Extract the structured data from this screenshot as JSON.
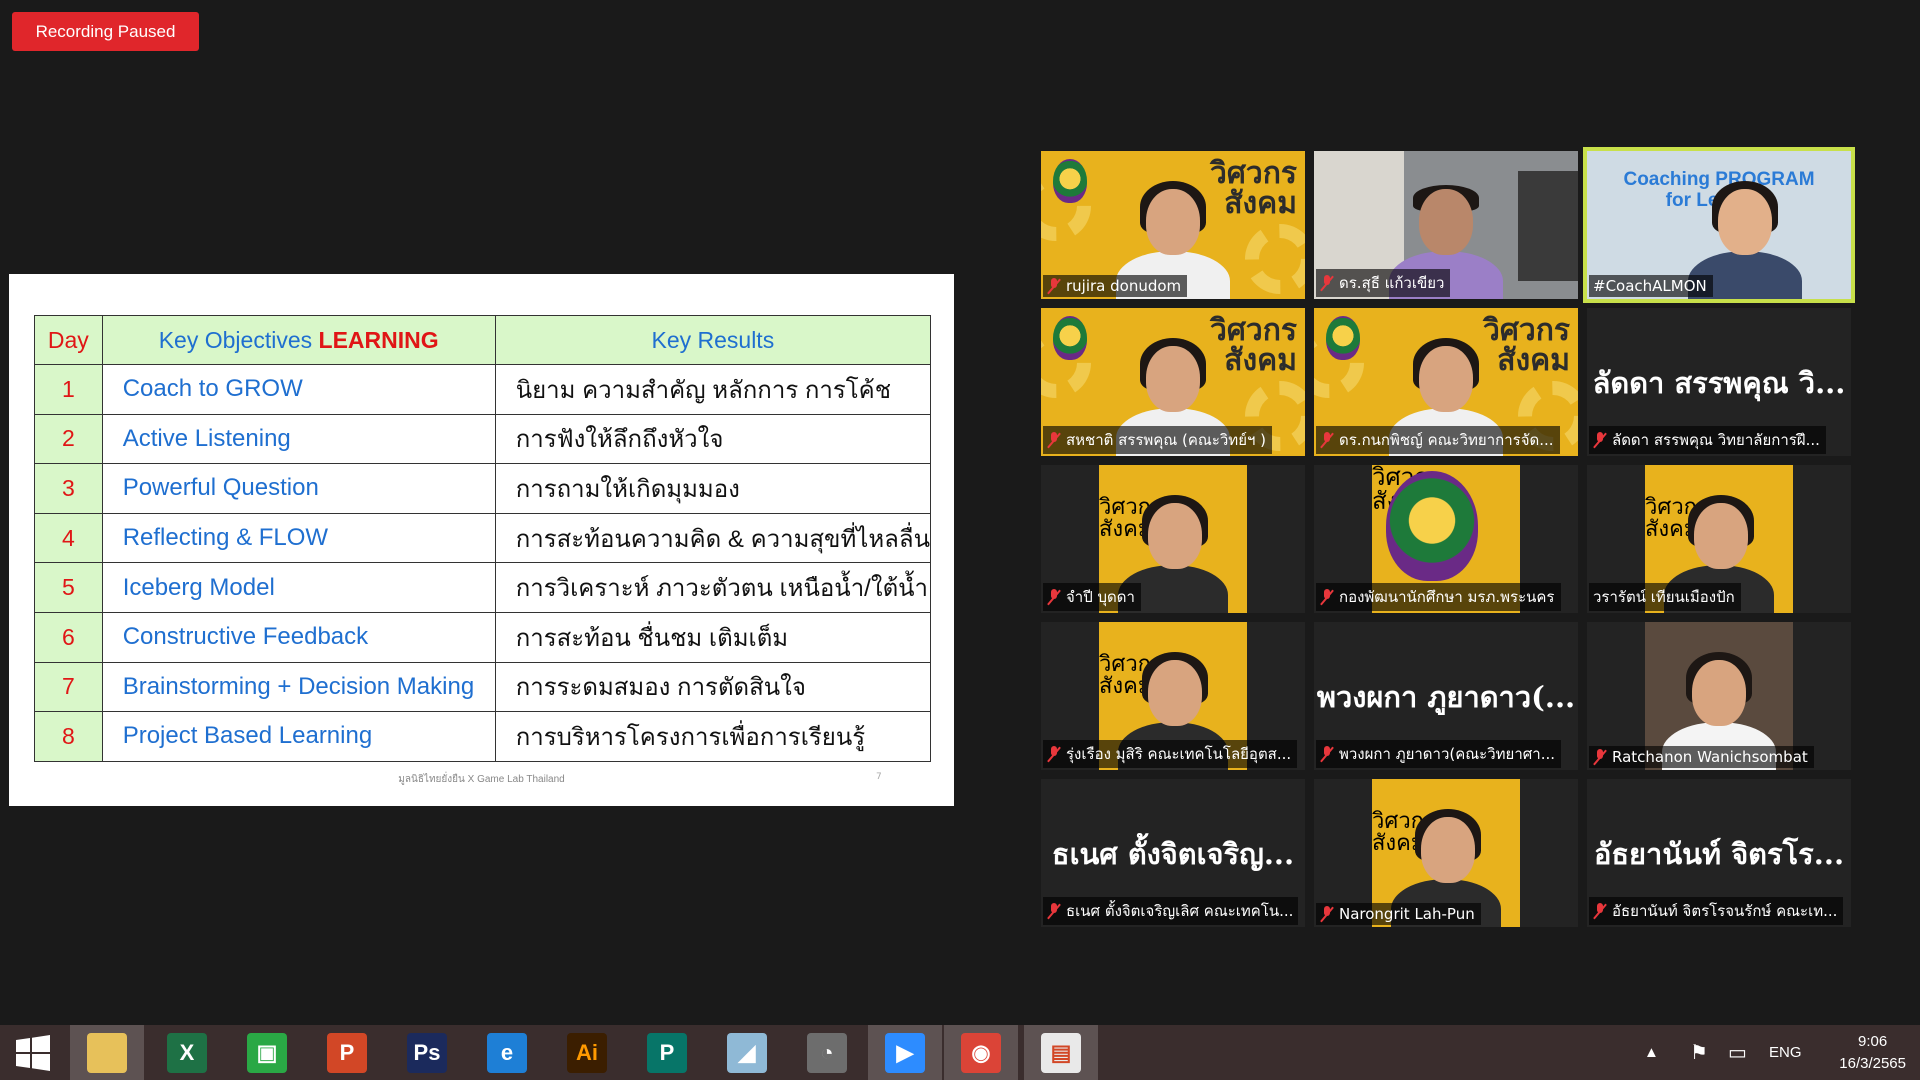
{
  "recording": {
    "label": "Recording Paused"
  },
  "slide": {
    "headers": {
      "day": "Day",
      "objectives_prefix": "Key Objectives ",
      "objectives_highlight": "LEARNING",
      "results": "Key Results"
    },
    "rows": [
      {
        "day": "1",
        "objective": "Coach to GROW",
        "result": "นิยาม ความสำคัญ หลักการ การโค้ช"
      },
      {
        "day": "2",
        "objective": "Active Listening",
        "result": "การฟังให้ลึกถึงหัวใจ"
      },
      {
        "day": "3",
        "objective": "Powerful Question",
        "result": "การถามให้เกิดมุมมอง"
      },
      {
        "day": "4",
        "objective": "Reflecting & FLOW",
        "result": "การสะท้อนความคิด & ความสุขที่ไหลลื่น"
      },
      {
        "day": "5",
        "objective": "Iceberg Model",
        "result": "การวิเคราะห์ ภาวะตัวตน เหนือน้ำ/ใต้น้ำ"
      },
      {
        "day": "6",
        "objective": "Constructive Feedback",
        "result": "การสะท้อน ชื่นชม เติมเต็ม"
      },
      {
        "day": "7",
        "objective": "Brainstorming + Decision Making",
        "result": "การระดมสมอง การตัดสินใจ"
      },
      {
        "day": "8",
        "objective": "Project Based Learning",
        "result": "การบริหารโครงการเพื่อการเรียนรู้"
      }
    ],
    "footer": "มูลนิธิไทยยั่งยืน X Game Lab Thailand",
    "page_number": "7"
  },
  "uni_banner": "วิศวกร\nสังคม",
  "coach_banner": "Coaching PROGRAM\nfor Lecturer",
  "participants": [
    {
      "name": "rujira donudom",
      "type": "camera",
      "muted": true
    },
    {
      "name": "ดร.สุธี แก้วเขียว",
      "type": "room",
      "muted": true
    },
    {
      "name": "#CoachALMON",
      "type": "coach",
      "muted": false,
      "active": true
    },
    {
      "name": "สหชาติ สรรพคุณ (คณะวิทย์ฯ )",
      "type": "camera",
      "muted": true
    },
    {
      "name": "ดร.กนกพิชญ์ คณะวิทยาการจัด...",
      "type": "camera",
      "muted": true
    },
    {
      "name": "ลัดดา สรรพคุณ วิทยาลัยการฝึ...",
      "display_name": "ลัดดา สรรพคุณ วิ...",
      "type": "nocam",
      "muted": true
    },
    {
      "name": "จำปี บุดดา",
      "type": "narrow",
      "muted": true
    },
    {
      "name": "กองพัฒนานักศึกษา มรภ.พระนคร",
      "type": "narrow-logo",
      "muted": true
    },
    {
      "name": "วรารัตน์ เทียนเมืองปัก",
      "type": "narrow",
      "muted": false
    },
    {
      "name": "รุ่งเรือง มุสิริ คณะเทคโนโลยีอุตส...",
      "type": "narrow",
      "muted": true
    },
    {
      "name": "พวงผกา ภูยาดาว(คณะวิทยาศา...",
      "display_name": "พวงผกา ภูยาดาว(...",
      "type": "nocam",
      "muted": true
    },
    {
      "name": "Ratchanon Wanichsombat",
      "type": "narrow-photo",
      "muted": true
    },
    {
      "name": "ธเนศ ตั้งจิตเจริญเลิศ คณะเทคโน...",
      "display_name": "ธเนศ ตั้งจิตเจริญ...",
      "type": "nocam",
      "muted": true
    },
    {
      "name": "Narongrit Lah-Pun",
      "type": "narrow",
      "muted": true
    },
    {
      "name": "อัธยานันท์ จิตรโรจนรักษ์ คณะเท...",
      "display_name": "อัธยานันท์ จิตรโร...",
      "type": "nocam",
      "muted": true
    }
  ],
  "taskbar": {
    "apps": [
      {
        "icon": "file-explorer-icon",
        "label": "",
        "color": "#e7c15a"
      },
      {
        "icon": "excel-icon",
        "label": "X",
        "color": "#1e7145"
      },
      {
        "icon": "store-icon",
        "label": "▣",
        "color": "#2aa845"
      },
      {
        "icon": "powerpoint-icon",
        "label": "P",
        "color": "#d24726"
      },
      {
        "icon": "photoshop-icon",
        "label": "Ps",
        "color": "#1b2a5c"
      },
      {
        "icon": "internet-explorer-icon",
        "label": "e",
        "color": "#1e7fd6"
      },
      {
        "icon": "illustrator-icon",
        "label": "Ai",
        "color": "#3b1e00"
      },
      {
        "icon": "publisher-icon",
        "label": "P",
        "color": "#077568"
      },
      {
        "icon": "notes-icon",
        "label": "◢",
        "color": "#8fb9d6"
      },
      {
        "icon": "photoscape-icon",
        "label": "◔",
        "color": "#6d6d6d"
      },
      {
        "icon": "zoom-icon",
        "label": "▶",
        "color": "#2d8cff"
      },
      {
        "icon": "chrome-icon",
        "label": "◉",
        "color": "#db4437"
      },
      {
        "icon": "powerpoint-show-icon",
        "label": "▤",
        "color": "#e9e9e9"
      }
    ],
    "tray": {
      "language": "ENG",
      "time": "9:06",
      "date": "16/3/2565"
    }
  }
}
